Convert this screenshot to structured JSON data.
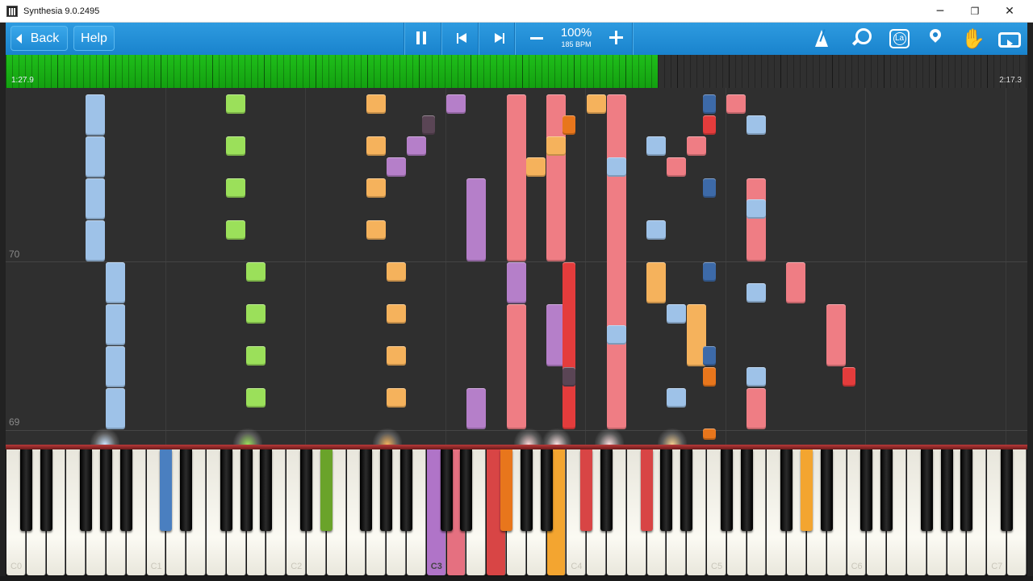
{
  "window": {
    "title": "Synthesia 9.0.2495",
    "minimize": "─",
    "maximize": "❐",
    "close": "✕"
  },
  "toolbar": {
    "back_label": "Back",
    "help_label": "Help",
    "speed_percent": "100%",
    "speed_bpm": "185 BPM",
    "label_icon_text": "La",
    "hand_glyph": "✋"
  },
  "progress": {
    "current_time": "1:27.9",
    "total_time": "2:17.3",
    "fraction": 0.638
  },
  "measures": [
    "70",
    "69"
  ],
  "keyboard": {
    "octave_labels": [
      "C0",
      "C1",
      "C2",
      "C3",
      "C4",
      "C5",
      "C6",
      "C7"
    ],
    "highlighted_label": "C3"
  },
  "colors": {
    "blue": "#9ec2e8",
    "green": "#9be05a",
    "orange": "#f5b25c",
    "purple": "#b57fc9",
    "pink": "#ef7d84",
    "red": "#e43c3c",
    "darkblue": "#3d6aa8",
    "darkorange": "#e8761c",
    "darkpurple": "#5a4555"
  },
  "active_keys": {
    "blue": "#4a7fc0",
    "green": "#6aa32a",
    "orange": "#e8761c",
    "red": "#d84545",
    "pink": "#e57080",
    "purple": "#b074c8",
    "amber": "#f3a530"
  }
}
